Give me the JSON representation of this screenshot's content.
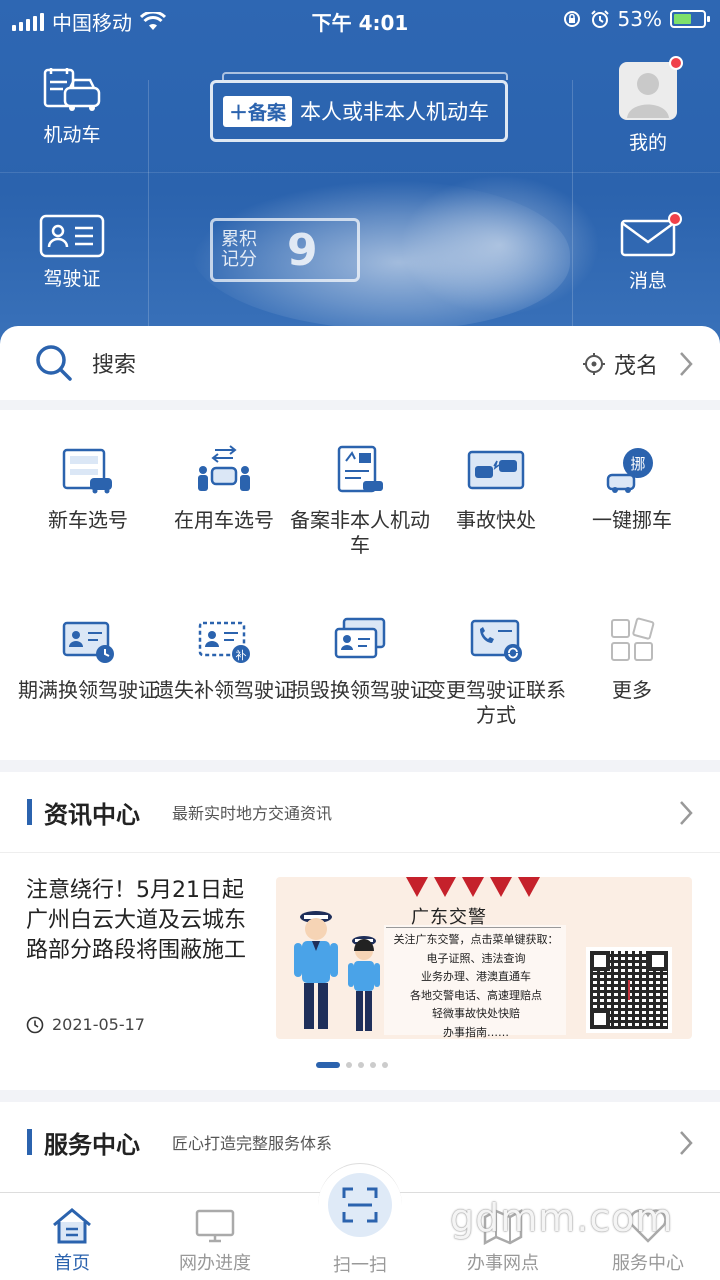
{
  "status_bar": {
    "carrier": "中国移动",
    "time": "下午 4:01",
    "battery": "53%",
    "battery_level": 0.53
  },
  "header": {
    "vehicle_label": "机动车",
    "license_label": "驾驶证",
    "record_tag": "备案",
    "record_text": "本人或非本人机动车",
    "points_label": "累积记分",
    "points_value": "9",
    "profile_label": "我的",
    "message_label": "消息"
  },
  "search": {
    "placeholder": "搜索",
    "location": "茂名"
  },
  "services": [
    {
      "label": "新车选号",
      "icon": "new-plate-icon"
    },
    {
      "label": "在用车选号",
      "icon": "car-people-icon"
    },
    {
      "label": "备案非本人机动车",
      "icon": "record-doc-icon"
    },
    {
      "label": "事故快处",
      "icon": "accident-icon"
    },
    {
      "label": "一键挪车",
      "icon": "move-car-icon"
    },
    {
      "label": "期满换领驾驶证",
      "icon": "license-expire-icon"
    },
    {
      "label": "遗失补领驾驶证",
      "icon": "license-lost-icon"
    },
    {
      "label": "损毁换领驾驶证",
      "icon": "license-damaged-icon"
    },
    {
      "label": "变更驾驶证联系方式",
      "icon": "license-contact-icon"
    },
    {
      "label": "更多",
      "icon": "more-grid-icon"
    }
  ],
  "news": {
    "title": "资讯中心",
    "subtitle": "最新实时地方交通资讯",
    "item_title": "注意绕行！5月21日起广州白云大道及云城东路部分路段将围蔽施工",
    "item_date": "2021-05-17",
    "banner": {
      "title": "广东交警",
      "lines": [
        "关注广东交警，点击菜单键获取：",
        "电子证照、违法查询",
        "业务办理、港澳直通车",
        "各地交警电话、高速理赔点",
        "轻微事故快处快赔",
        "办事指南……"
      ]
    },
    "carousel_count": 5,
    "carousel_active": 1
  },
  "service_center": {
    "title": "服务中心",
    "subtitle": "匠心打造完整服务体系"
  },
  "tabs": [
    {
      "label": "首页",
      "icon": "home-icon",
      "active": true
    },
    {
      "label": "网办进度",
      "icon": "monitor-icon",
      "active": false
    },
    {
      "label": "扫一扫",
      "icon": "scan-icon",
      "active": false
    },
    {
      "label": "办事网点",
      "icon": "map-icon",
      "active": false
    },
    {
      "label": "服务中心",
      "icon": "heart-icon",
      "active": false
    }
  ],
  "watermark": "gdmm.com",
  "colors": {
    "primary": "#2b63ae",
    "badge": "#f0414a"
  }
}
